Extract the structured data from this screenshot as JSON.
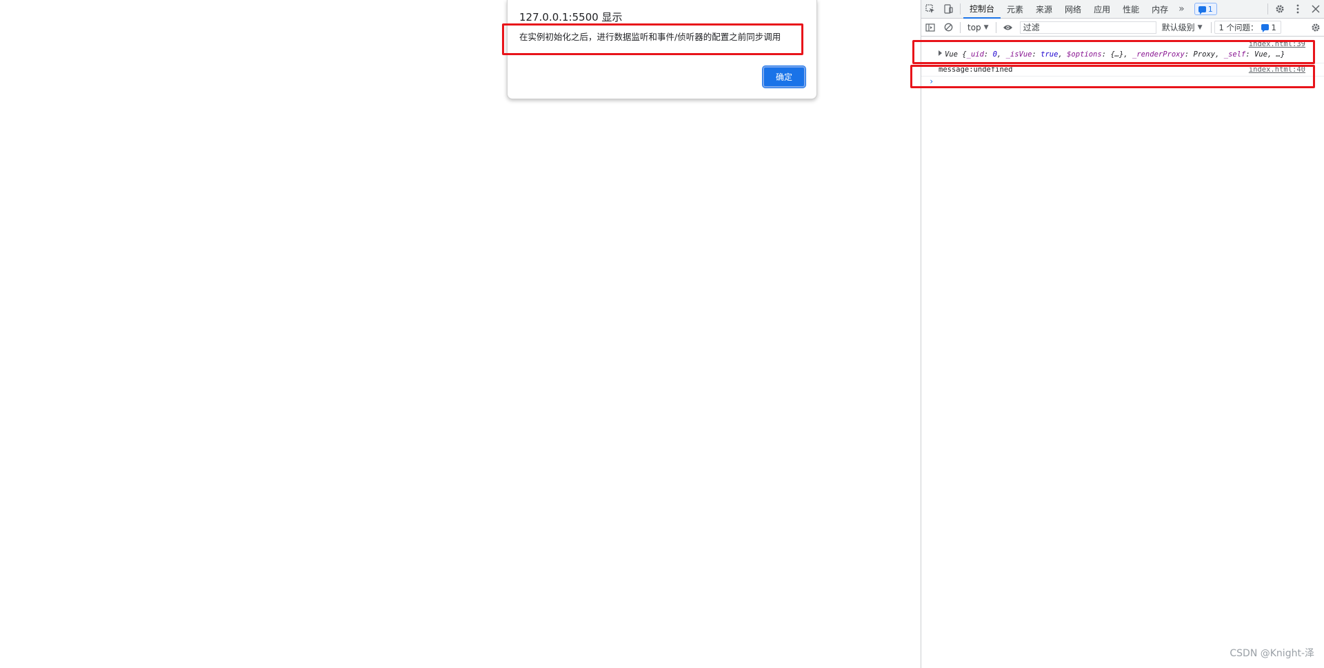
{
  "alert": {
    "origin": "127.0.0.1:5500 显示",
    "message": "在实例初始化之后，进行数据监听和事件/侦听器的配置之前同步调用",
    "ok_label": "确定"
  },
  "devtools": {
    "tabs": [
      {
        "label": "控制台",
        "active": true
      },
      {
        "label": "元素"
      },
      {
        "label": "来源"
      },
      {
        "label": "网络"
      },
      {
        "label": "应用"
      },
      {
        "label": "性能"
      },
      {
        "label": "内存"
      }
    ],
    "more_tabs": "»",
    "message_badge_count": "1",
    "toolbar": {
      "context": "top",
      "filter_placeholder": "过滤",
      "level": "默认级别",
      "issues_label": "1 个问题：",
      "issues_count": "1"
    },
    "logs": [
      {
        "source": "index.html:39",
        "object": {
          "name": "Vue",
          "uid_key": "_uid",
          "uid_val": "0",
          "isvue_key": "_isVue",
          "isvue_val": "true",
          "options_key": "$options",
          "options_val": "{…}",
          "proxy_key": "_renderProxy",
          "proxy_val": "Proxy",
          "self_key": "_self",
          "self_val": "Vue",
          "tail": "…}"
        }
      },
      {
        "source": "index.html:40",
        "text": "message:undefined"
      }
    ],
    "prompt": "›"
  },
  "watermark": "CSDN @Knight-泽",
  "colors": {
    "accent": "#1a73e8",
    "annotation": "#e8141a"
  }
}
